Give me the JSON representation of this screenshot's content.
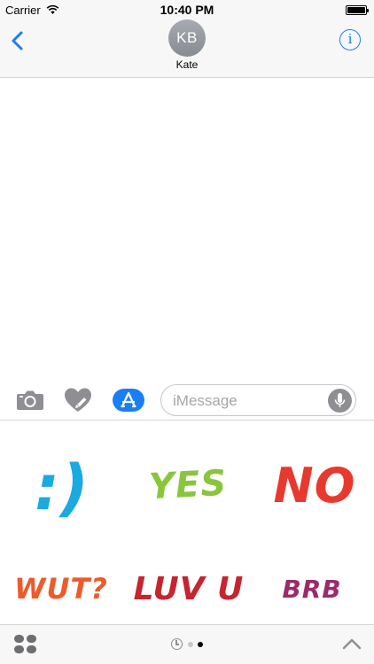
{
  "status_bar": {
    "carrier": "Carrier",
    "time": "10:40 PM",
    "icons": [
      "wifi-icon",
      "battery-icon"
    ]
  },
  "header": {
    "back_icon": "chevron-left-icon",
    "avatar_initials": "KB",
    "contact_name": "Kate",
    "info_icon": "info-icon",
    "info_glyph": "i",
    "accent_color": "#1a7ef6"
  },
  "input_bar": {
    "camera_icon": "camera-icon",
    "digital_touch_icon": "heart-icon",
    "app_store_icon": "app-store-icon",
    "message_placeholder": "iMessage",
    "mic_icon": "microphone-icon"
  },
  "stickers": [
    {
      "label": ":)",
      "color": "#1aa9e0"
    },
    {
      "label": "YES",
      "color": "#8ac53e"
    },
    {
      "label": "NO",
      "color": "#e8392f"
    },
    {
      "label": "WUT?",
      "color": "#ef5a2a"
    },
    {
      "label": "LUV U",
      "color": "#c62430"
    },
    {
      "label": "BRB",
      "color": "#9c2a6b"
    }
  ],
  "bottom_bar": {
    "app_drawer_icon": "app-drawer-icon",
    "recents_icon": "clock-icon",
    "page_count": 2,
    "active_page": 2,
    "expand_icon": "chevron-up-icon"
  }
}
